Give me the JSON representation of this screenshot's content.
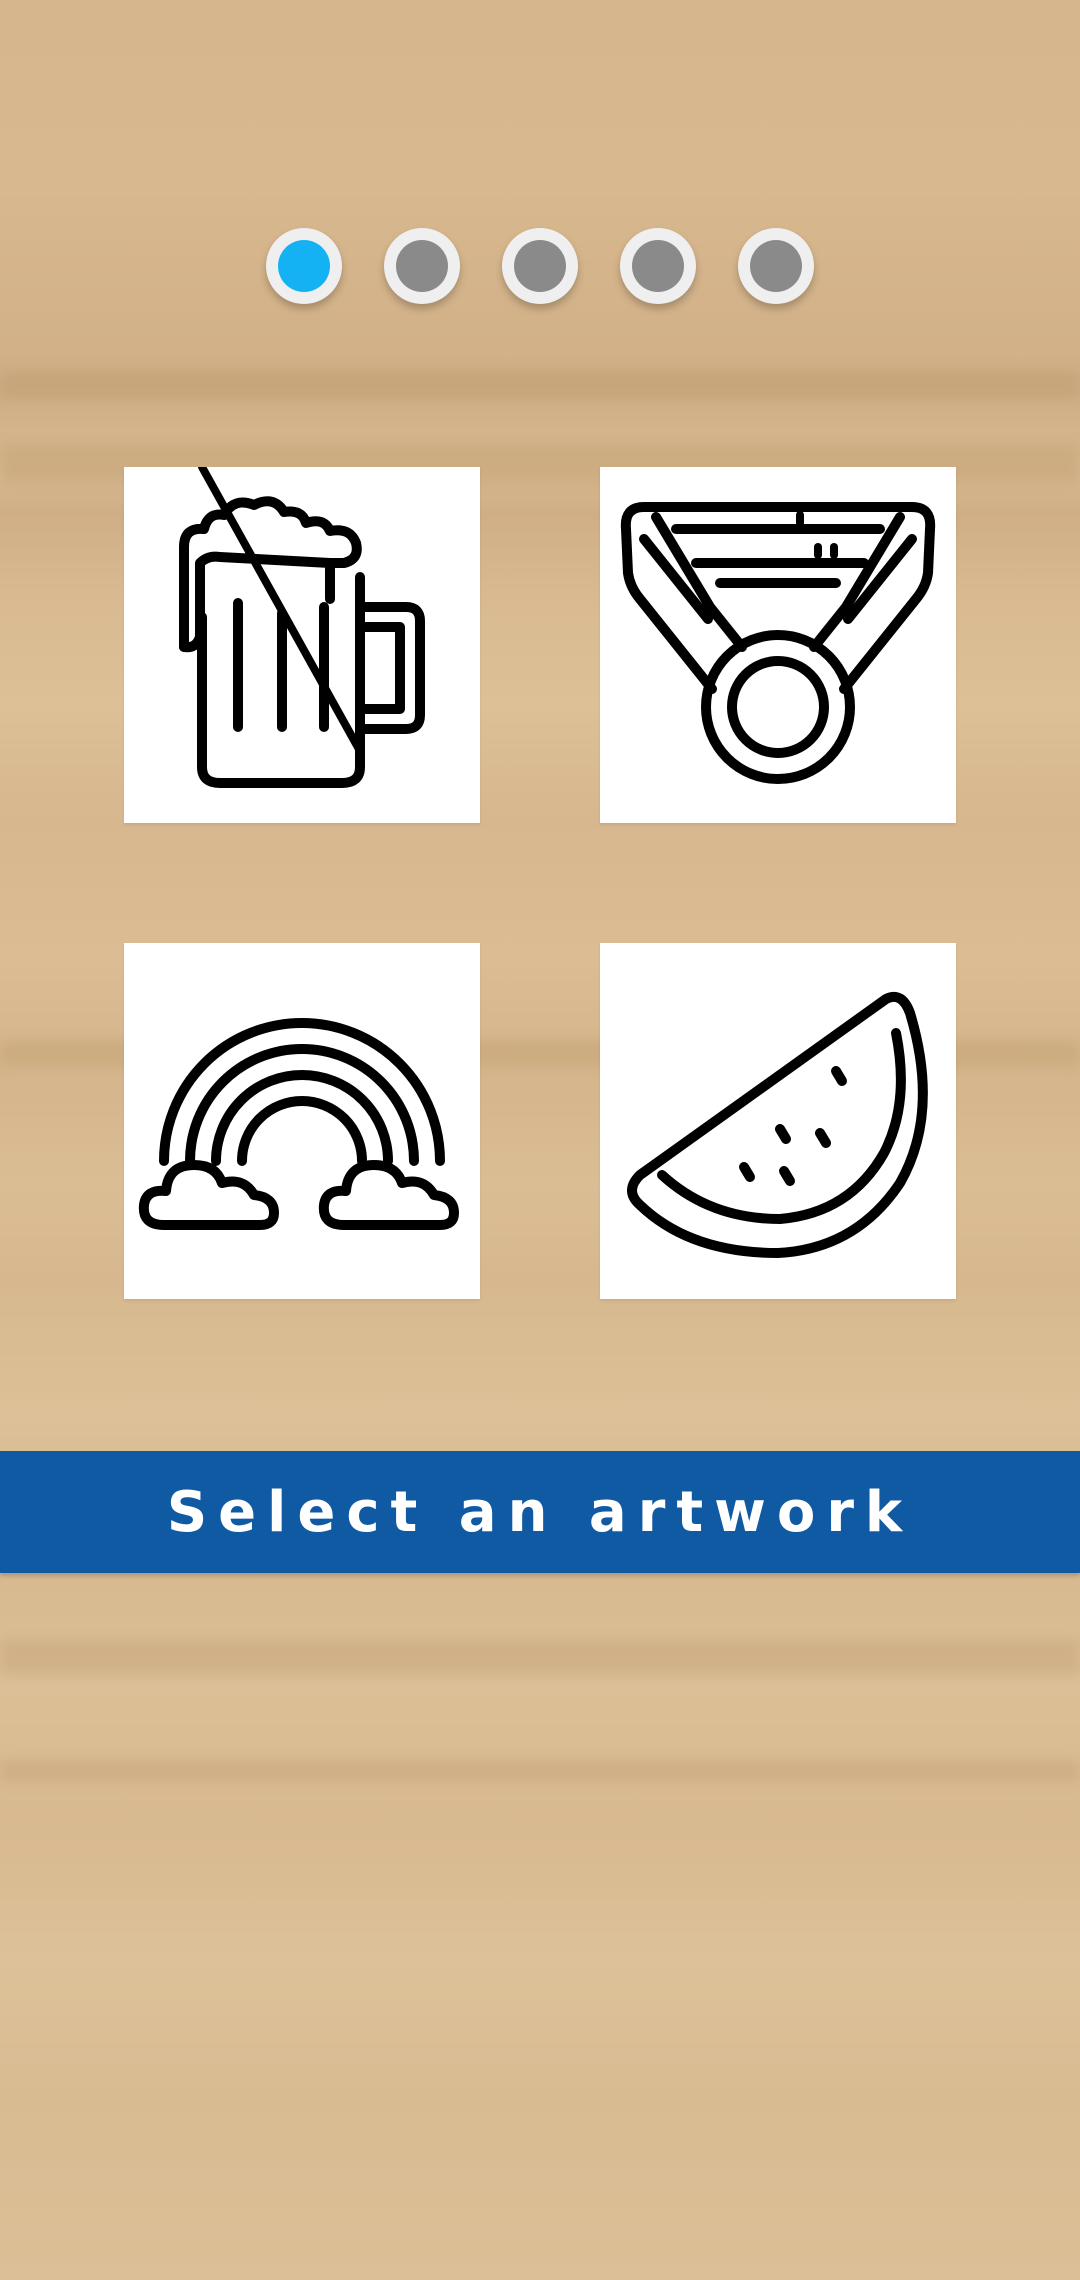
{
  "pager": {
    "count": 5,
    "active_index": 0,
    "active_color": "#14b2f2",
    "inactive_color": "#8a8a8a"
  },
  "artworks": [
    {
      "icon": "beer-mug-icon"
    },
    {
      "icon": "medal-icon"
    },
    {
      "icon": "rainbow-icon"
    },
    {
      "icon": "watermelon-slice-icon"
    }
  ],
  "banner": {
    "label": "Select an artwork",
    "color": "#0f5aa3"
  },
  "background": {
    "texture": "light wood",
    "color": "#d8b88f"
  }
}
